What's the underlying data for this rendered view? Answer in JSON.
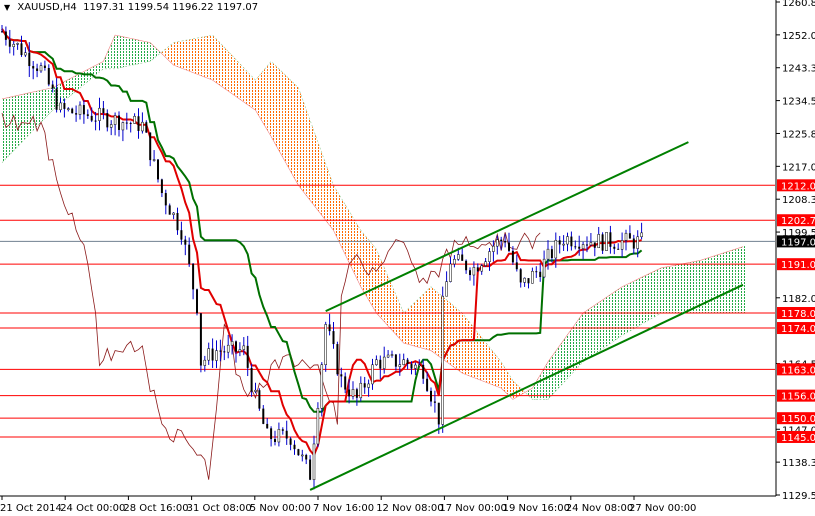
{
  "header": {
    "symbol": "XAUUSD,H4",
    "open": "1197.31",
    "high": "1199.54",
    "low": "1196.22",
    "close": "1197.07"
  },
  "chart_data": {
    "type": "candlestick",
    "title": "XAUUSD,H4",
    "ylim": [
      1129.55,
      1260.8
    ],
    "y_ticks": [
      "1260.80",
      "1252.05",
      "1243.30",
      "1234.55",
      "1225.80",
      "1217.05",
      "1208.30",
      "1199.55",
      "1182.05",
      "1164.55",
      "1147.05",
      "1138.30",
      "1129.55"
    ],
    "x_ticks": [
      "21 Oct 2014",
      "24 Oct 00:00",
      "28 Oct 16:00",
      "31 Oct 08:00",
      "5 Nov 00:00",
      "7 Nov 16:00",
      "12 Nov 08:00",
      "17 Nov 00:00",
      "19 Nov 16:00",
      "24 Nov 08:00",
      "27 Nov 00:00"
    ],
    "current_price": "1197.07",
    "levels": [
      "1212.00",
      "1202.70",
      "1191.00",
      "1178.00",
      "1174.00",
      "1163.00",
      "1156.00",
      "1150.00",
      "1145.00"
    ],
    "price_path_bar_price": [
      [
        0,
        1253
      ],
      [
        5,
        1248
      ],
      [
        10,
        1243
      ],
      [
        15,
        1232
      ],
      [
        26,
        1230
      ],
      [
        36,
        1228
      ],
      [
        41,
        1210
      ],
      [
        46,
        1200
      ],
      [
        50,
        1180
      ],
      [
        51,
        1165
      ],
      [
        55,
        1168
      ],
      [
        62,
        1168
      ],
      [
        65,
        1155
      ],
      [
        68,
        1145
      ],
      [
        74,
        1145
      ],
      [
        79,
        1135
      ],
      [
        83,
        1175
      ],
      [
        87,
        1160
      ],
      [
        91,
        1155
      ],
      [
        96,
        1165
      ],
      [
        103,
        1165
      ],
      [
        108,
        1163
      ],
      [
        112,
        1150
      ],
      [
        113,
        1180
      ],
      [
        115,
        1192
      ],
      [
        121,
        1190
      ],
      [
        126,
        1196
      ],
      [
        129,
        1198
      ],
      [
        133,
        1185
      ],
      [
        138,
        1190
      ],
      [
        144,
        1198
      ],
      [
        154,
        1197
      ],
      [
        164,
        1197
      ]
    ],
    "cloud_bar_spanA_spanB": [
      [
        0,
        1235,
        1218
      ],
      [
        13,
        1238,
        1232
      ],
      [
        26,
        1245,
        1243
      ],
      [
        29,
        1252,
        1243
      ],
      [
        38,
        1250,
        1245
      ],
      [
        44,
        1244,
        1250
      ],
      [
        54,
        1240,
        1252
      ],
      [
        65,
        1232,
        1240
      ],
      [
        69,
        1225,
        1245
      ],
      [
        76,
        1212,
        1238
      ],
      [
        85,
        1200,
        1212
      ],
      [
        92,
        1185,
        1200
      ],
      [
        96,
        1178,
        1195
      ],
      [
        103,
        1170,
        1178
      ],
      [
        110,
        1168,
        1185
      ],
      [
        118,
        1162,
        1178
      ],
      [
        128,
        1158,
        1165
      ],
      [
        131,
        1155,
        1160
      ],
      [
        136,
        1158,
        1155
      ],
      [
        140,
        1165,
        1155
      ],
      [
        149,
        1178,
        1165
      ],
      [
        159,
        1185,
        1172
      ],
      [
        169,
        1190,
        1178
      ],
      [
        179,
        1192,
        1178
      ],
      [
        191,
        1196,
        1178
      ]
    ],
    "trendlines_bar_price": [
      [
        [
          83,
          1178.5
        ],
        [
          176,
          1223.5
        ]
      ],
      [
        [
          79,
          1130.9
        ],
        [
          190,
          1185.5
        ]
      ]
    ],
    "colors": {
      "level": "#ff0000",
      "trend": "#008000",
      "tenkan": "#e00000",
      "kijun": "#007000",
      "chikou": "#8b1a1a",
      "bear_cloud": "#ff6a00",
      "bull_cloud": "#22aa44",
      "candle": "#0000cc"
    }
  }
}
